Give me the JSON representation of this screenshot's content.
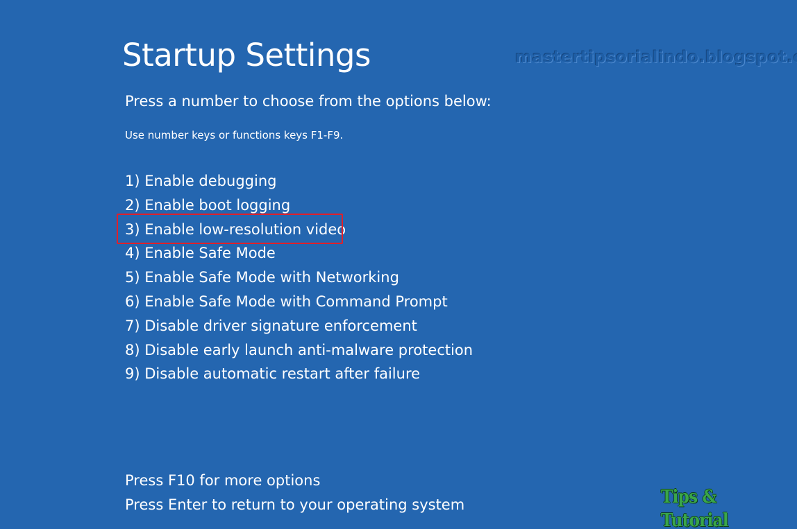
{
  "screen": {
    "title": "Startup Settings",
    "watermark": "mastertipsorialindo.blogspot.com",
    "subtitle": "Press a number to choose from the options below:",
    "hint": "Use number keys or functions keys F1-F9.",
    "options": [
      {
        "label": "1) Enable debugging"
      },
      {
        "label": "2) Enable boot logging"
      },
      {
        "label": "3) Enable low-resolution video",
        "highlighted": true
      },
      {
        "label": "4) Enable Safe Mode"
      },
      {
        "label": "5) Enable Safe Mode with Networking"
      },
      {
        "label": "6) Enable Safe Mode with Command Prompt"
      },
      {
        "label": "7) Disable driver signature enforcement"
      },
      {
        "label": "8) Disable early launch anti-malware protection"
      },
      {
        "label": "9) Disable automatic restart after failure"
      }
    ],
    "footer": {
      "more_options": "Press F10 for more options",
      "return": "Press Enter to return to your operating system"
    },
    "logo_text": "Tips & Tutorial"
  },
  "colors": {
    "background": "#2466b0",
    "text": "#ffffff",
    "highlight_border": "#e0202a",
    "logo": "#3aa64a"
  }
}
